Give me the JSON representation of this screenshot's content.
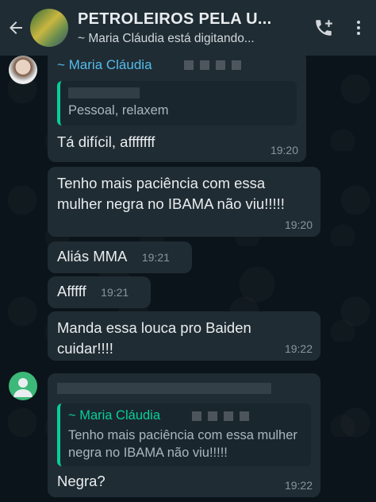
{
  "header": {
    "title": "PETROLEIROS PELA U...",
    "subtitle": "~ Maria Cláudia está digitando..."
  },
  "messages": [
    {
      "sender": "~ Maria Cláudia",
      "quote_text": "Pessoal, relaxem",
      "text": "Tá difícil,  afffffff",
      "time": "19:20"
    },
    {
      "text": "Tenho mais paciência com essa mulher negra no IBAMA não viu!!!!!",
      "time": "19:20"
    },
    {
      "text": "Aliás MMA",
      "time": "19:21"
    },
    {
      "text": "Afffff",
      "time": "19:21"
    },
    {
      "text": "Manda essa louca pro Baiden cuidar!!!!",
      "time": "19:22"
    },
    {
      "quote_sender": "~ Maria Cláudia",
      "quote_text": "Tenho mais paciência com essa mulher negra no IBAMA não viu!!!!!",
      "text": "Negra?",
      "time": "19:22"
    }
  ],
  "icons": {
    "back": "arrow-left-icon",
    "add_call": "add-call-icon",
    "menu": "more-vert-icon"
  },
  "colors": {
    "header_bg": "#1f2c34",
    "bubble_bg": "#202c33",
    "quote_accent": "#06cf9c",
    "sender_color": "#53bdeb"
  }
}
